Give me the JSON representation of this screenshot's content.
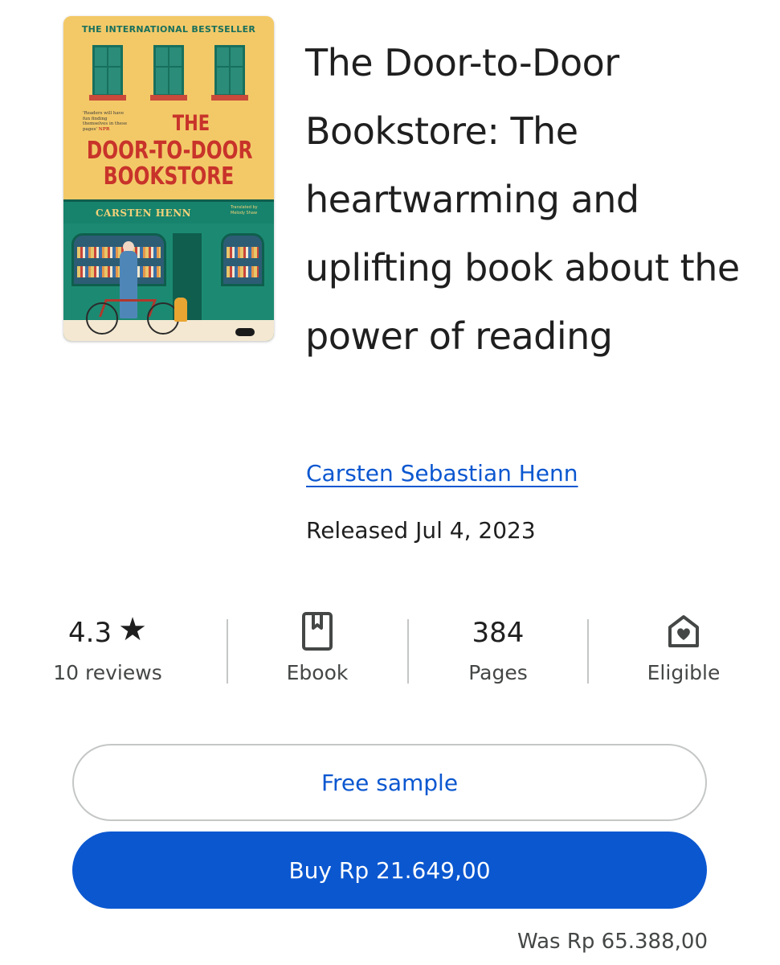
{
  "book": {
    "title": "The Door-to-Door Bookstore: The heartwarming and uplifting book about the power of reading",
    "author": "Carsten Sebastian Henn",
    "released": "Released Jul 4, 2023"
  },
  "cover": {
    "bestseller_line": "THE INTERNATIONAL BESTSELLER",
    "quote": "'Readers will have fun finding themselves in these pages'",
    "quote_source": "NPR",
    "title_line1": "THE",
    "title_line2": "DOOR-TO-DOOR",
    "title_line3": "BOOKSTORE",
    "author": "CARSTEN HENN",
    "translated_by": "Translated by Melody Shaw"
  },
  "stats": {
    "rating": {
      "value": "4.3",
      "label": "10 reviews",
      "icon": "star-icon"
    },
    "format": {
      "label": "Ebook",
      "icon": "ebook-icon"
    },
    "pages": {
      "value": "384",
      "label": "Pages"
    },
    "family": {
      "label": "Eligible",
      "icon": "family-library-icon"
    }
  },
  "actions": {
    "sample_label": "Free sample",
    "buy_label": "Buy Rp 21.649,00",
    "was_price": "Was Rp 65.388,00"
  },
  "colors": {
    "accent": "#0b57d0",
    "text": "#1f1f1f",
    "secondary_text": "#444746",
    "outline": "#c4c7c5"
  }
}
